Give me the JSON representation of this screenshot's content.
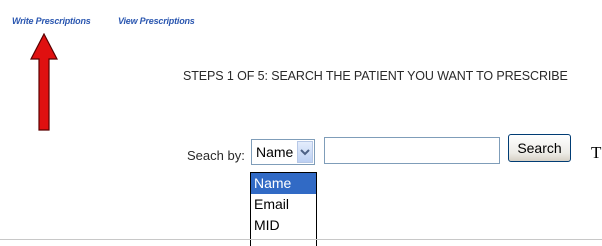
{
  "nav": {
    "write_label": "Write Prescriptions",
    "view_label": "View Prescriptions"
  },
  "steps_text": "STEPS 1 OF 5: SEARCH THE PATIENT YOU WANT TO PRESCRIBE",
  "stray_text": "T",
  "search": {
    "label": "Seach by:",
    "selected": "Name",
    "options": [
      "Name",
      "Email",
      "MID"
    ],
    "input_value": "",
    "button_label": "Search"
  },
  "colors": {
    "link": "#2b57b0",
    "arrow": "#e01010",
    "highlight": "#316ac5"
  },
  "annotation": {
    "icon": "red-arrow-up-icon"
  }
}
